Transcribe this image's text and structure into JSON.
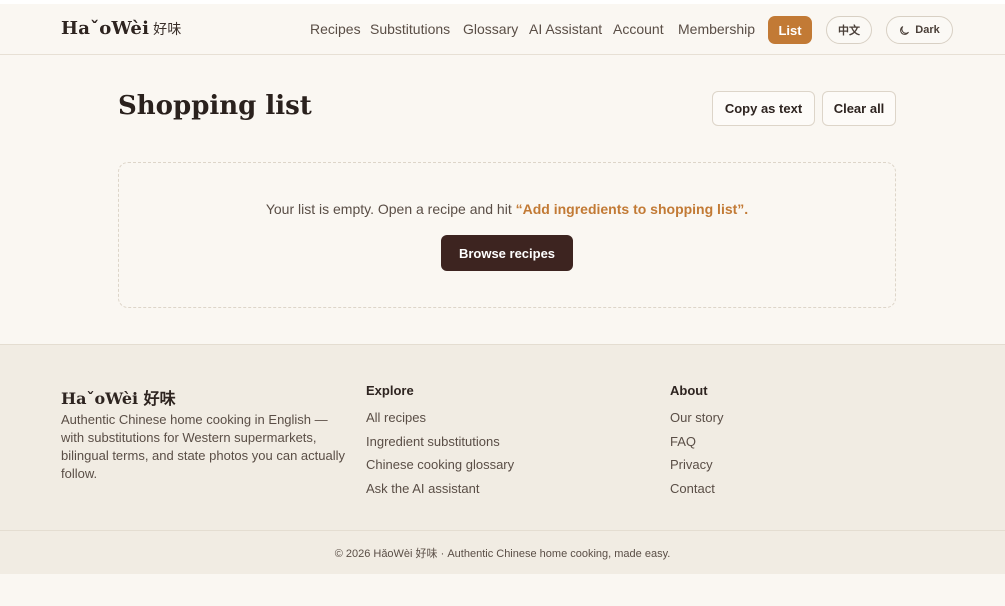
{
  "header": {
    "logo_latin": "HaˇoWèi",
    "logo_cn": "好味",
    "nav": [
      "Recipes",
      "Substitutions",
      "Glossary",
      "AI Assistant",
      "Account",
      "Membership"
    ],
    "list_label": "List",
    "lang_label": "中文",
    "theme_label": "Dark",
    "accent_color": "#c27a35",
    "theme_icon": "moon-icon"
  },
  "main": {
    "title": "Shopping list",
    "copy_label": "Copy as text",
    "clear_label": "Clear all",
    "empty_text": "Your list is empty. Open a recipe and hit ",
    "empty_highlight": "“Add ingredients to shopping list”.",
    "browse_label": "Browse recipes",
    "browse_color": "#3d2420"
  },
  "footer": {
    "logo": "HaˇoWèi 好味",
    "description": "Authentic Chinese home cooking in English — with substitutions for Western supermarkets, bilingual terms, and state photos you can actually follow.",
    "explore_heading": "Explore",
    "explore_links": [
      "All recipes",
      "Ingredient substitutions",
      "Chinese cooking glossary",
      "Ask the AI assistant"
    ],
    "about_heading": "About",
    "about_links": [
      "Our story",
      "FAQ",
      "Privacy",
      "Contact"
    ],
    "copyright": "© 2026 HǎoWèi 好味 · Authentic Chinese home cooking, made easy."
  }
}
